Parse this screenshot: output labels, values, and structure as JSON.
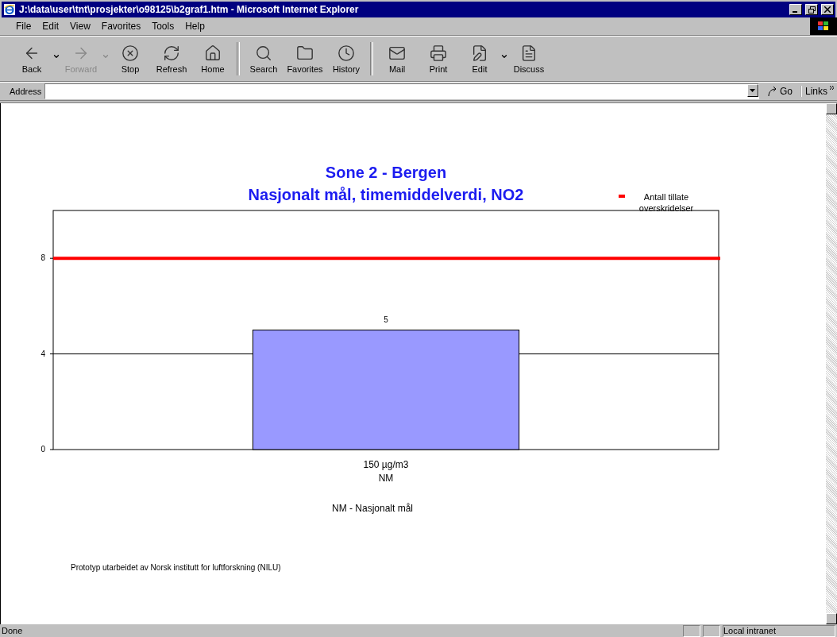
{
  "window": {
    "title": "J:\\data\\user\\tnt\\prosjekter\\o98125\\b2graf1.htm - Microsoft Internet Explorer"
  },
  "menu": [
    "File",
    "Edit",
    "View",
    "Favorites",
    "Tools",
    "Help"
  ],
  "toolbar": [
    {
      "kind": "back",
      "label": "Back",
      "disabled": false,
      "dropdown": true
    },
    {
      "kind": "forward",
      "label": "Forward",
      "disabled": true,
      "dropdown": true
    },
    {
      "kind": "stop",
      "label": "Stop",
      "disabled": false,
      "dropdown": false
    },
    {
      "kind": "refresh",
      "label": "Refresh",
      "disabled": false,
      "dropdown": false
    },
    {
      "kind": "home",
      "label": "Home",
      "disabled": false,
      "dropdown": false
    },
    {
      "kind": "separator"
    },
    {
      "kind": "search",
      "label": "Search",
      "disabled": false,
      "dropdown": false
    },
    {
      "kind": "favorites",
      "label": "Favorites",
      "disabled": false,
      "dropdown": false
    },
    {
      "kind": "history",
      "label": "History",
      "disabled": false,
      "dropdown": false
    },
    {
      "kind": "separator"
    },
    {
      "kind": "mail",
      "label": "Mail",
      "disabled": false,
      "dropdown": false
    },
    {
      "kind": "print",
      "label": "Print",
      "disabled": false,
      "dropdown": false
    },
    {
      "kind": "edit",
      "label": "Edit",
      "disabled": false,
      "dropdown": true
    },
    {
      "kind": "discuss",
      "label": "Discuss",
      "disabled": false,
      "dropdown": false
    }
  ],
  "address_bar": {
    "label": "Address",
    "go": "Go",
    "links": "Links"
  },
  "page": {
    "title_lines": [
      "Sone 2 - Bergen",
      "Nasjonalt mål, timemiddelverdi, NO2"
    ],
    "chart_data": {
      "type": "bar",
      "categories": [
        "150 µg/m3"
      ],
      "xlabel": "NM",
      "ylim": [
        0,
        10
      ],
      "yticks": [
        0,
        4,
        8
      ],
      "value_labels": [
        "5"
      ],
      "series": [
        {
          "color": "#9999ff",
          "values": [
            5
          ]
        }
      ],
      "ref_lines": [
        {
          "axis": "y",
          "value": 8,
          "label": "Antall tillate overskridelser",
          "color": "#ff0000"
        },
        {
          "axis": "y",
          "value": 4,
          "color": "#000000"
        }
      ]
    },
    "note": "NM  - Nasjonalt mål",
    "footer": "Prototyp utarbeidet av Norsk institutt for luftforskning (NILU)"
  },
  "status_bar": {
    "text": "Done",
    "zone": "Local intranet"
  }
}
